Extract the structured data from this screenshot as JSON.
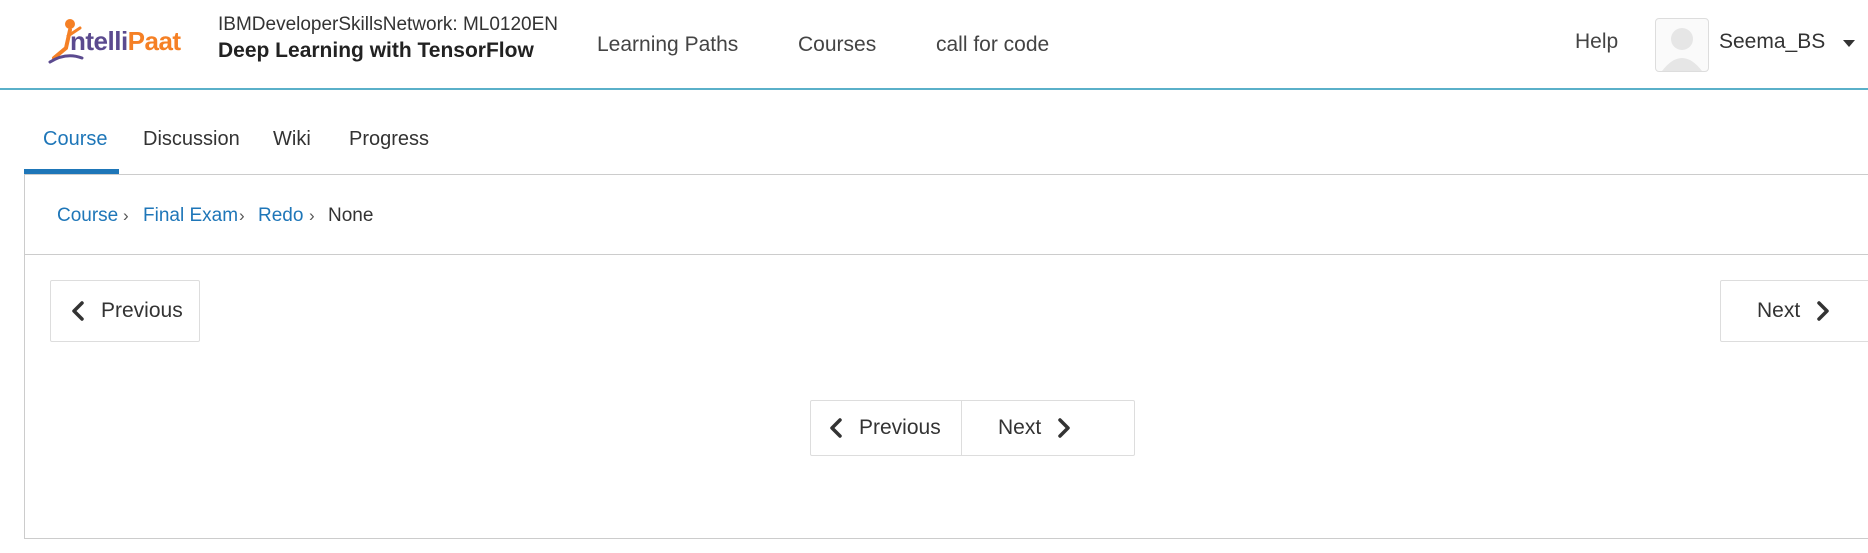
{
  "header": {
    "logo": {
      "text_left": "ntelli",
      "text_right": "Paat",
      "prefix": "I"
    },
    "course_org": "IBMDeveloperSkillsNetwork: ML0120EN",
    "course_title": "Deep Learning with TensorFlow",
    "nav": [
      "Learning Paths",
      "Courses",
      "call for code"
    ],
    "help": "Help",
    "username": "Seema_BS"
  },
  "tabs": [
    {
      "label": "Course",
      "active": true
    },
    {
      "label": "Discussion",
      "active": false
    },
    {
      "label": "Wiki",
      "active": false
    },
    {
      "label": "Progress",
      "active": false
    }
  ],
  "breadcrumb": {
    "items": [
      "Course",
      "Final Exam",
      "Redo"
    ],
    "current": "None"
  },
  "sequence_nav": {
    "top_previous": "Previous",
    "top_next": "Next",
    "bottom_previous": "Previous",
    "bottom_next": "Next"
  },
  "colors": {
    "accent": "#1e76b8",
    "header_border": "#5ab0c9",
    "logo_purple": "#5b4a8f",
    "logo_orange": "#f58025"
  },
  "icons": [
    "chevron-left-icon",
    "chevron-right-icon",
    "chevron-down-icon",
    "avatar-icon"
  ]
}
